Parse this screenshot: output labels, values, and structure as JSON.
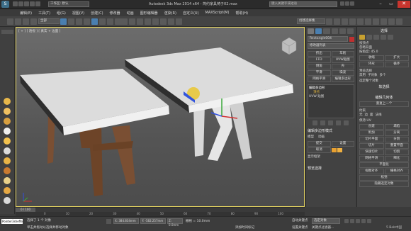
{
  "title_bar": {
    "workspace": "工作区: 默认",
    "title": "Autodesk 3ds Max 2014 x64 - 简约家具椅子02.max",
    "search_placeholder": "键入关键字或短语"
  },
  "menu": [
    "编辑(E)",
    "工具(T)",
    "组(G)",
    "视图(V)",
    "创建(C)",
    "修改器",
    "动画",
    "图形编辑器",
    "渲染(R)",
    "自定义(U)",
    "MAXScript(M)",
    "帮助(H)"
  ],
  "toolbar": {
    "filter": "全部",
    "selection_set": "创建选择集"
  },
  "viewport": {
    "label": "[ + ] [ 透视 ] [ 真实 + 边面 ]"
  },
  "command_panel": {
    "object_name": "Rectangle004",
    "modifier_list": "修改器列表",
    "mod_buttons": [
      [
        "挤出",
        "车削"
      ],
      [
        "FFD",
        "UVW贴图"
      ],
      [
        "倒角",
        "壳"
      ],
      [
        "平滑",
        "噪波"
      ],
      [
        "网格平滑",
        "编辑多边形"
      ]
    ],
    "stack": [
      "编辑多边形",
      "顶点",
      "UVW 贴图"
    ],
    "section": "编辑多边形模式",
    "mode": "模型",
    "mode2": "动画",
    "commit": "提交",
    "settings": "设置",
    "cancel": "取消",
    "show_cage": "显示框架",
    "preview": "预览选择"
  },
  "right_panel": {
    "title": "选择",
    "checks": [
      "按顶点",
      "忽略背面",
      "按角度: 45.0"
    ],
    "shrink": "收缩",
    "grow": "扩大",
    "ring": "环形",
    "loop": "循环",
    "preview_label": "预览选择",
    "off": "禁用",
    "subobj": "子对象",
    "multi": "多个",
    "whole": "选定整个对象",
    "soft": "软选择",
    "edit_geo": "编辑几何体",
    "repeat": "重复上一个",
    "constraints": "约束",
    "none": "无",
    "edge": "边",
    "face": "面",
    "normal": "法线",
    "preserve_uv": "保持 UV",
    "create": "创建",
    "collapse": "塌陷",
    "attach": "附加",
    "detach": "分离",
    "slice_plane": "切片平面",
    "split": "分割",
    "slice": "切片",
    "reset_plane": "重置平面",
    "quickslice": "快速切片",
    "cut": "切割",
    "msmooth": "网格平滑",
    "tessellate": "细化",
    "make_planar": "平面化",
    "view_align": "视图对齐",
    "grid_align": "栅格对齐",
    "relax": "松弛",
    "hide_sel": "隐藏选定对象"
  },
  "status": {
    "selected": "选择了 1 个 对象",
    "prompt": "单击并拖动以选择并移动对象",
    "time": "0 / 100",
    "x": "X: 384.834mm",
    "y": "Y: -582.257mm",
    "z": "Z: 0.0mm",
    "grid": "栅格 = 10.0mm",
    "autokey": "自动关键点",
    "setkey": "设置关键点",
    "selected_mode": "选定对象",
    "filter": "关键点过滤器...",
    "add_tag": "添加时间标记",
    "user": "Pointer3sheffe",
    "watermark": "5 Bob中国"
  },
  "timeline_ticks": [
    "0",
    "10",
    "20",
    "30",
    "40",
    "50",
    "60",
    "70",
    "80",
    "90",
    "100"
  ]
}
